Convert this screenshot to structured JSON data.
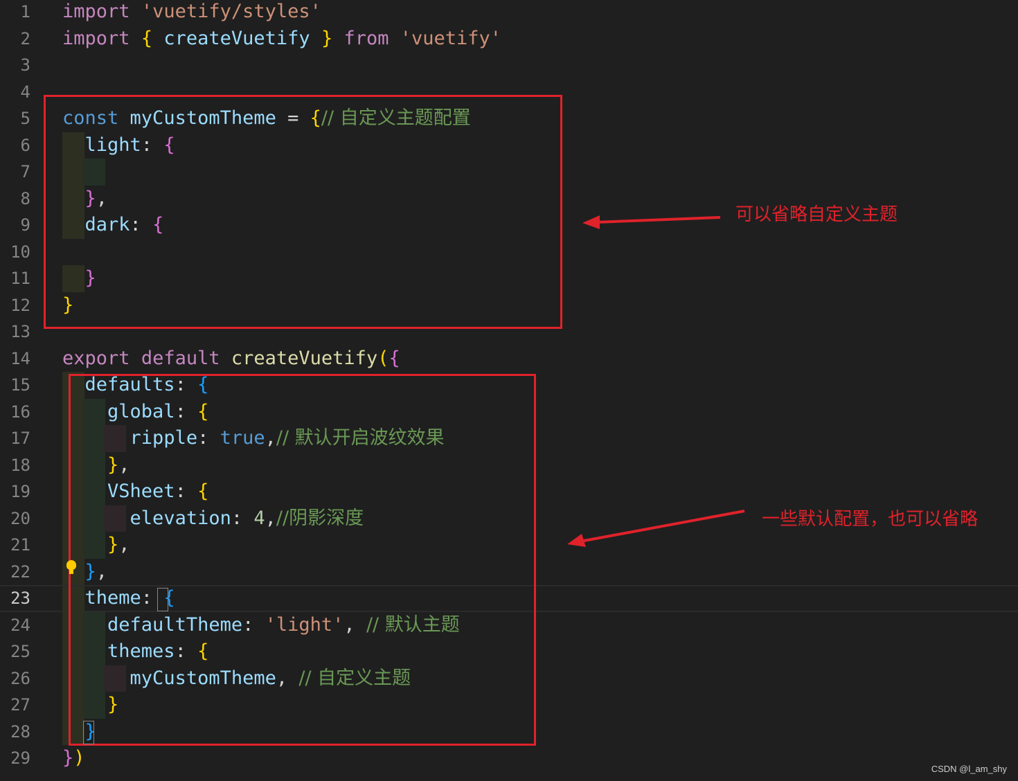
{
  "editor": {
    "active_line": 23,
    "lines": [
      {
        "n": "1",
        "t": [
          [
            "kw",
            "import"
          ],
          [
            "punc",
            " "
          ],
          [
            "str",
            "'vuetify/styles'"
          ]
        ]
      },
      {
        "n": "2",
        "t": [
          [
            "kw",
            "import"
          ],
          [
            "punc",
            " "
          ],
          [
            "b1",
            "{"
          ],
          [
            "punc",
            " "
          ],
          [
            "var",
            "createVuetify"
          ],
          [
            "punc",
            " "
          ],
          [
            "b1",
            "}"
          ],
          [
            "punc",
            " "
          ],
          [
            "kw",
            "from"
          ],
          [
            "punc",
            " "
          ],
          [
            "str",
            "'vuetify'"
          ]
        ]
      },
      {
        "n": "3",
        "t": []
      },
      {
        "n": "4",
        "t": []
      },
      {
        "n": "5",
        "t": [
          [
            "kwb",
            "const"
          ],
          [
            "punc",
            " "
          ],
          [
            "var",
            "myCustomTheme"
          ],
          [
            "punc",
            " = "
          ],
          [
            "b1",
            "{"
          ],
          [
            "cm",
            "// 自定义主题配置"
          ]
        ]
      },
      {
        "n": "6",
        "t": [
          [
            "punc",
            "  "
          ],
          [
            "var",
            "light"
          ],
          [
            "punc",
            ": "
          ],
          [
            "b2",
            "{"
          ]
        ]
      },
      {
        "n": "7",
        "t": []
      },
      {
        "n": "8",
        "t": [
          [
            "punc",
            "  "
          ],
          [
            "b2",
            "}"
          ],
          [
            "punc",
            ","
          ]
        ]
      },
      {
        "n": "9",
        "t": [
          [
            "punc",
            "  "
          ],
          [
            "var",
            "dark"
          ],
          [
            "punc",
            ": "
          ],
          [
            "b2",
            "{"
          ]
        ]
      },
      {
        "n": "10",
        "t": []
      },
      {
        "n": "11",
        "t": [
          [
            "punc",
            "  "
          ],
          [
            "b2",
            "}"
          ]
        ]
      },
      {
        "n": "12",
        "t": [
          [
            "b1",
            "}"
          ]
        ]
      },
      {
        "n": "13",
        "t": []
      },
      {
        "n": "14",
        "t": [
          [
            "kw",
            "export"
          ],
          [
            "punc",
            " "
          ],
          [
            "kw",
            "default"
          ],
          [
            "punc",
            " "
          ],
          [
            "fn",
            "createVuetify"
          ],
          [
            "b1",
            "("
          ],
          [
            "b2",
            "{"
          ]
        ]
      },
      {
        "n": "15",
        "t": [
          [
            "punc",
            "  "
          ],
          [
            "var",
            "defaults"
          ],
          [
            "punc",
            ": "
          ],
          [
            "b3",
            "{"
          ]
        ]
      },
      {
        "n": "16",
        "t": [
          [
            "punc",
            "    "
          ],
          [
            "var",
            "global"
          ],
          [
            "punc",
            ": "
          ],
          [
            "b1",
            "{"
          ]
        ]
      },
      {
        "n": "17",
        "t": [
          [
            "punc",
            "      "
          ],
          [
            "var",
            "ripple"
          ],
          [
            "punc",
            ": "
          ],
          [
            "kwb",
            "true"
          ],
          [
            "punc",
            ","
          ],
          [
            "cm",
            "// 默认开启波纹效果"
          ]
        ]
      },
      {
        "n": "18",
        "t": [
          [
            "punc",
            "    "
          ],
          [
            "b1",
            "}"
          ],
          [
            "punc",
            ","
          ]
        ]
      },
      {
        "n": "19",
        "t": [
          [
            "punc",
            "    "
          ],
          [
            "var",
            "VSheet"
          ],
          [
            "punc",
            ": "
          ],
          [
            "b1",
            "{"
          ]
        ]
      },
      {
        "n": "20",
        "t": [
          [
            "punc",
            "      "
          ],
          [
            "var",
            "elevation"
          ],
          [
            "punc",
            ": "
          ],
          [
            "num",
            "4"
          ],
          [
            "punc",
            ","
          ],
          [
            "cm",
            "//阴影深度"
          ]
        ]
      },
      {
        "n": "21",
        "t": [
          [
            "punc",
            "    "
          ],
          [
            "b1",
            "}"
          ],
          [
            "punc",
            ","
          ]
        ]
      },
      {
        "n": "22",
        "t": [
          [
            "punc",
            "  "
          ],
          [
            "b3",
            "}"
          ],
          [
            "punc",
            ","
          ]
        ]
      },
      {
        "n": "23",
        "t": [
          [
            "punc",
            "  "
          ],
          [
            "var",
            "theme"
          ],
          [
            "punc",
            ": "
          ],
          [
            "b3",
            "{"
          ]
        ]
      },
      {
        "n": "24",
        "t": [
          [
            "punc",
            "    "
          ],
          [
            "var",
            "defaultTheme"
          ],
          [
            "punc",
            ": "
          ],
          [
            "str",
            "'light'"
          ],
          [
            "punc",
            ", "
          ],
          [
            "cm",
            "// 默认主题"
          ]
        ]
      },
      {
        "n": "25",
        "t": [
          [
            "punc",
            "    "
          ],
          [
            "var",
            "themes"
          ],
          [
            "punc",
            ": "
          ],
          [
            "b1",
            "{"
          ]
        ]
      },
      {
        "n": "26",
        "t": [
          [
            "punc",
            "      "
          ],
          [
            "var",
            "myCustomTheme"
          ],
          [
            "punc",
            ", "
          ],
          [
            "cm",
            "// 自定义主题"
          ]
        ]
      },
      {
        "n": "27",
        "t": [
          [
            "punc",
            "    "
          ],
          [
            "b1",
            "}"
          ]
        ]
      },
      {
        "n": "28",
        "t": [
          [
            "punc",
            "  "
          ],
          [
            "b3",
            "}"
          ]
        ]
      },
      {
        "n": "29",
        "t": [
          [
            "b2",
            "}"
          ],
          [
            "b1",
            ")"
          ]
        ]
      }
    ]
  },
  "annotations": {
    "top": "可以省略自定义主题",
    "bottom": "一些默认配置，也可以省略"
  },
  "watermark": "CSDN @l_am_shy",
  "colors": {
    "annotation_red": "#e0222b",
    "background": "#1f1f1f"
  }
}
